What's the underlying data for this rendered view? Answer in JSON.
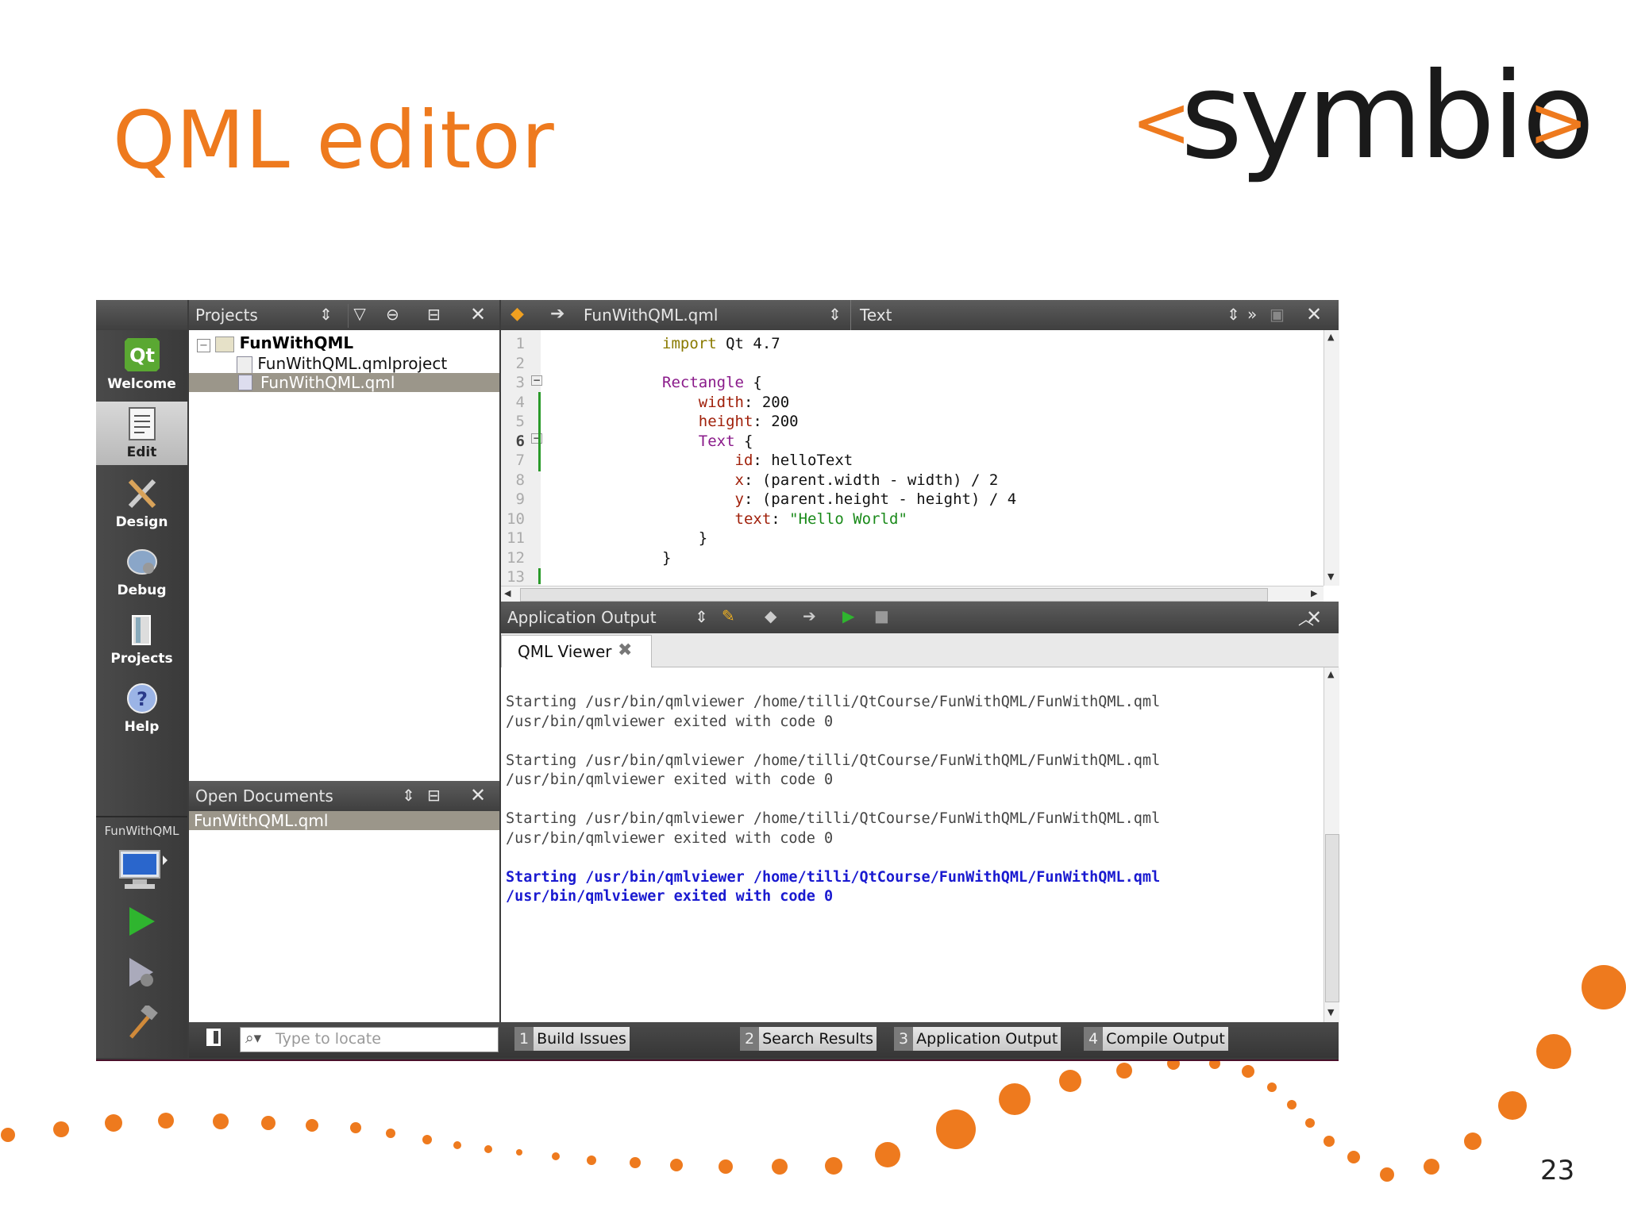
{
  "slide": {
    "title": "QML editor",
    "logo": {
      "left": "<",
      "word": "symbio",
      "right": ">"
    },
    "page_number": "23"
  },
  "colors": {
    "accent": "#ee7a1e",
    "dark": "#3c3c3c"
  },
  "modes": [
    {
      "label": "Welcome",
      "icon": "qt-logo-icon"
    },
    {
      "label": "Edit",
      "icon": "edit-document-icon"
    },
    {
      "label": "Design",
      "icon": "design-tools-icon"
    },
    {
      "label": "Debug",
      "icon": "debug-bug-icon"
    },
    {
      "label": "Projects",
      "icon": "projects-book-icon"
    },
    {
      "label": "Help",
      "icon": "help-icon"
    }
  ],
  "target": {
    "project": "FunWithQML"
  },
  "projects_panel": {
    "selector": "Projects",
    "tree": [
      {
        "label": "FunWithQML"
      },
      {
        "label": "FunWithQML.qmlproject"
      },
      {
        "label": "FunWithQML.qml"
      }
    ]
  },
  "open_documents": {
    "selector": "Open Documents",
    "items": [
      "FunWithQML.qml"
    ]
  },
  "locator": {
    "placeholder": "Type to locate"
  },
  "editor": {
    "file": "FunWithQML.qml",
    "symbol": "Text",
    "line_numbers": [
      "1",
      "2",
      "3",
      "4",
      "5",
      "6",
      "7",
      "8",
      "9",
      "10",
      "11",
      "12",
      "13"
    ]
  },
  "output_panel": {
    "title": "Application Output",
    "tab": "QML Viewer",
    "lines": [
      "Starting /usr/bin/qmlviewer /home/tilli/QtCourse/FunWithQML/FunWithQML.qml",
      "/usr/bin/qmlviewer exited with code 0",
      "",
      "Starting /usr/bin/qmlviewer /home/tilli/QtCourse/FunWithQML/FunWithQML.qml",
      "/usr/bin/qmlviewer exited with code 0",
      "",
      "Starting /usr/bin/qmlviewer /home/tilli/QtCourse/FunWithQML/FunWithQML.qml",
      "/usr/bin/qmlviewer exited with code 0",
      ""
    ],
    "highlight_lines": [
      "Starting /usr/bin/qmlviewer /home/tilli/QtCourse/FunWithQML/FunWithQML.qml",
      "/usr/bin/qmlviewer exited with code 0"
    ]
  },
  "bottom_tabs": [
    {
      "num": "1",
      "label": "Build Issues"
    },
    {
      "num": "2",
      "label": "Search Results"
    },
    {
      "num": "3",
      "label": "Application Output"
    },
    {
      "num": "4",
      "label": "Compile Output"
    }
  ],
  "code": {
    "l1_kw": "import",
    "l1_rest": " Qt 4.7",
    "l3_type": "Rectangle",
    "l3_rest": " {",
    "l4_prop": "width",
    "l4_rest": ": 200",
    "l5_prop": "height",
    "l5_rest": ": 200",
    "l6_type": "Text",
    "l6_rest": " {",
    "l7_prop": "id",
    "l7_rest": ": helloText",
    "l8_prop": "x",
    "l8_rest": ": (parent.width - width) / 2",
    "l9_prop": "y",
    "l9_rest": ": (parent.height - height) / 4",
    "l10_prop": "text",
    "l10_str": "\"Hello World\"",
    "l11": "}",
    "l12": "}"
  }
}
